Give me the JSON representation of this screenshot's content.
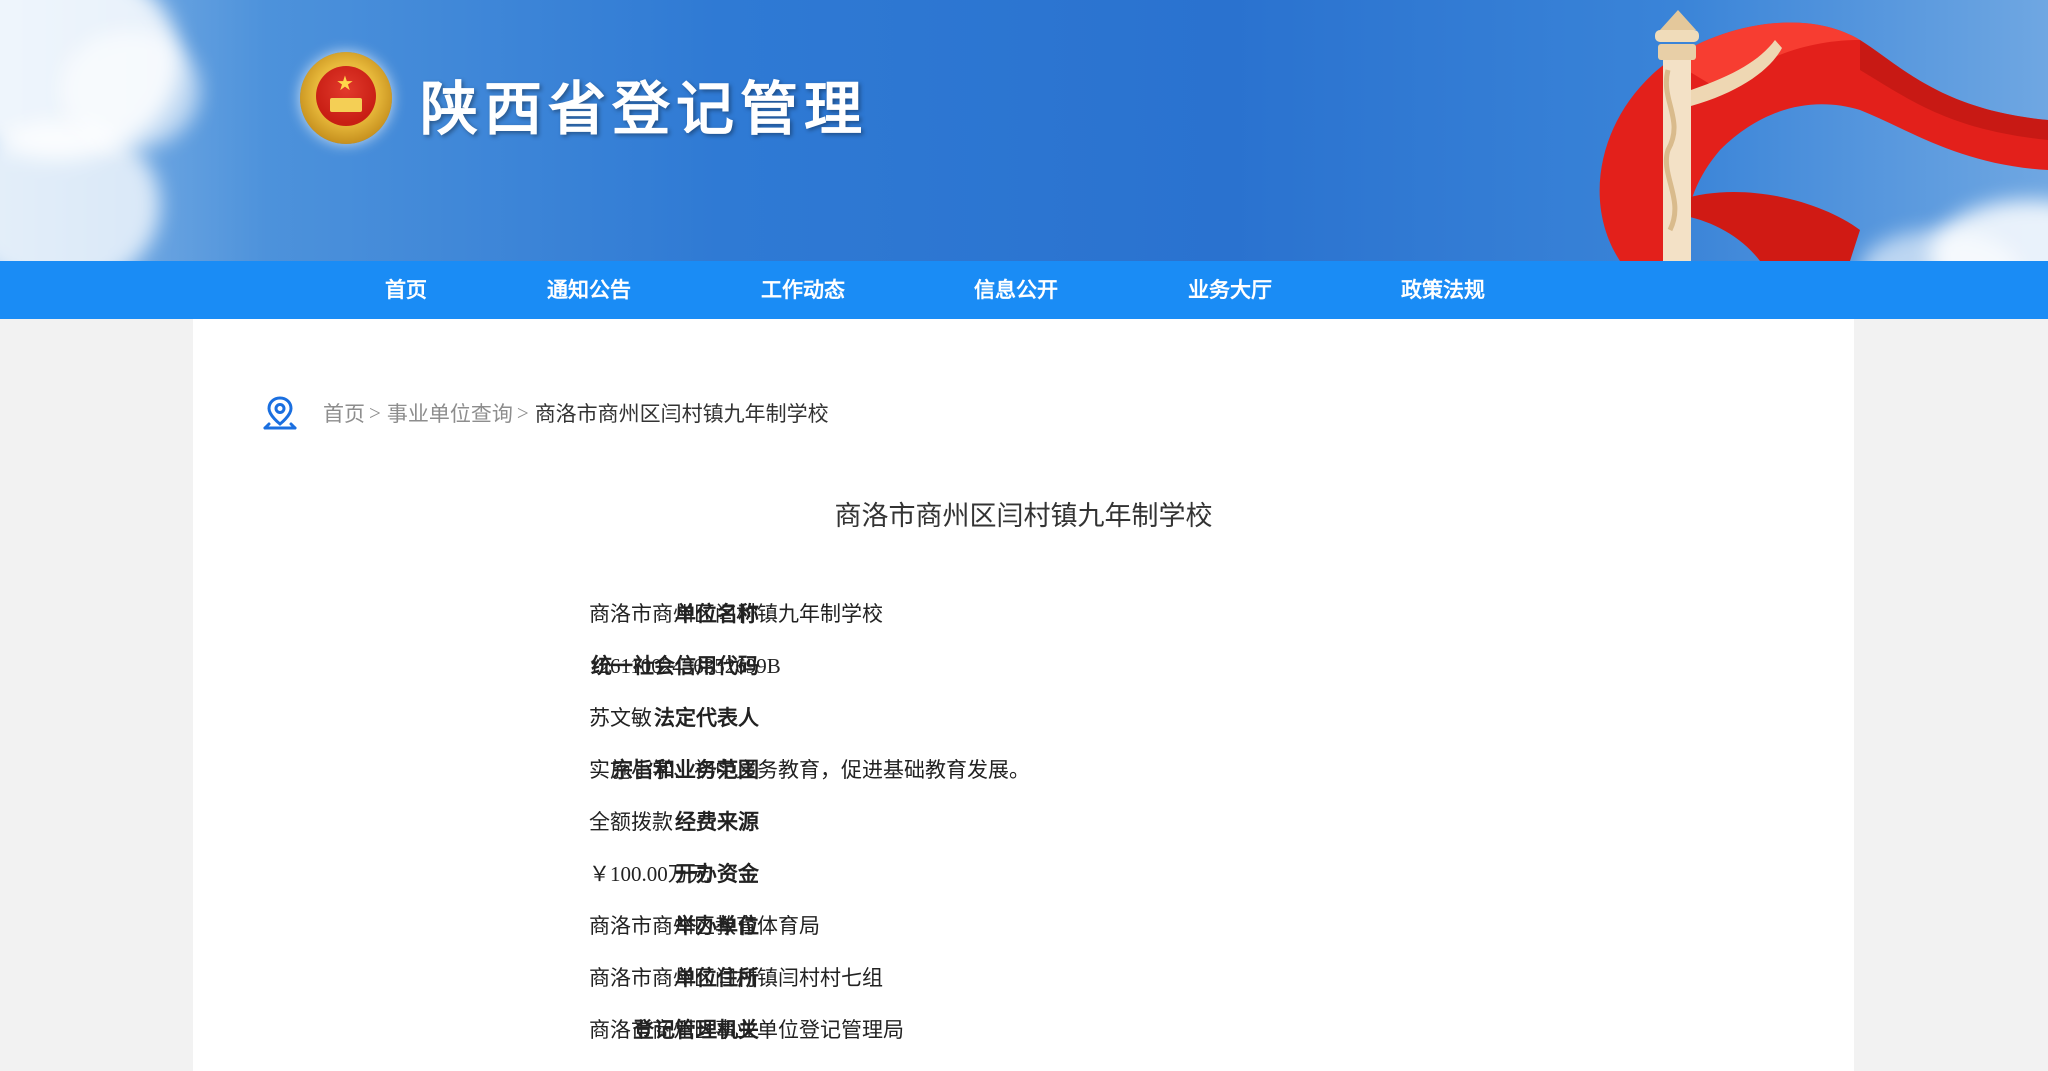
{
  "header": {
    "site_title": "陕西省登记管理",
    "emblem_icon": "national-emblem-icon",
    "colors": {
      "banner_blue": "#2a72cf",
      "nav_blue": "#1a8cf5",
      "flag_red": "#e3201b"
    }
  },
  "nav": {
    "items": [
      {
        "label": "首页"
      },
      {
        "label": "通知公告"
      },
      {
        "label": "工作动态"
      },
      {
        "label": "信息公开"
      },
      {
        "label": "业务大厅"
      },
      {
        "label": "政策法规"
      }
    ]
  },
  "breadcrumb": {
    "icon": "location-pin-icon",
    "items": [
      {
        "label": "首页",
        "sep": ">"
      },
      {
        "label": "事业单位查询",
        "sep": ">"
      }
    ],
    "current": "商洛市商州区闫村镇九年制学校"
  },
  "page": {
    "title": "商洛市商州区闫村镇九年制学校"
  },
  "details": {
    "rows": [
      {
        "label": "单位名称",
        "value": "商洛市商州区闫村镇九年制学校"
      },
      {
        "label": "统一社会信用代码",
        "value": "12611002436352699B"
      },
      {
        "label": "法定代表人",
        "value": "苏文敏"
      },
      {
        "label": "宗旨和业务范围",
        "value": "实施小学、初中义务教育，促进基础教育发展。"
      },
      {
        "label": "经费来源",
        "value": "全额拨款"
      },
      {
        "label": "开办资金",
        "value": "￥100.00万元"
      },
      {
        "label": "举办单位",
        "value": "商洛市商州区教育体育局"
      },
      {
        "label": "单位住所",
        "value": "商洛市商州区闫村镇闫村村七组"
      },
      {
        "label": "登记管理机关",
        "value": "商洛市商州区事业单位登记管理局"
      }
    ]
  }
}
